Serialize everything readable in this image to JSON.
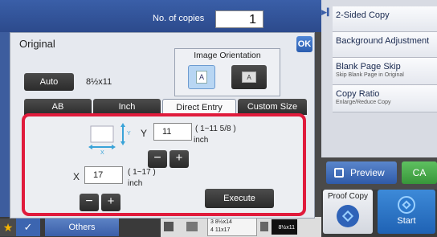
{
  "header": {
    "copies_label": "No. of copies",
    "copies_value": "1"
  },
  "right_panel": {
    "items": [
      {
        "label": "2-Sided Copy",
        "sub": ""
      },
      {
        "label": "Background Adjustment",
        "sub": ""
      },
      {
        "label": "Blank Page Skip",
        "sub": "Skip Blank Page in Original"
      },
      {
        "label": "Copy Ratio",
        "sub": "Enlarge/Reduce Copy"
      }
    ],
    "preview_label": "Preview",
    "ca_label": "CA",
    "proof_label": "Proof Copy",
    "start_label": "Start"
  },
  "bottom_bar": {
    "star_icon": "★",
    "check_icon": "✓",
    "others_label": "Others",
    "tray_rows": [
      "3   8½x14",
      "4   11x17"
    ],
    "tray_size": "8½x11"
  },
  "dialog": {
    "title": "Original",
    "ok_label": "OK",
    "orientation_label": "Image Orientation",
    "orientation_glyph_a": "A",
    "orientation_glyph_b": "A",
    "auto_label": "Auto",
    "auto_size": "8½x11",
    "tabs": [
      "AB",
      "Inch",
      "Direct Entry",
      "Custom Size"
    ],
    "active_tab": 2,
    "y_label": "Y",
    "y_value": "11",
    "y_range": "( 1~11 5/8 )",
    "y_unit": "inch",
    "x_label": "X",
    "x_value": "17",
    "x_range": "( 1~17 )",
    "x_unit": "inch",
    "minus_label": "−",
    "plus_label": "+",
    "execute_label": "Execute"
  },
  "colors": {
    "highlight": "#e01b3c",
    "accent": "#2c5eb0"
  }
}
